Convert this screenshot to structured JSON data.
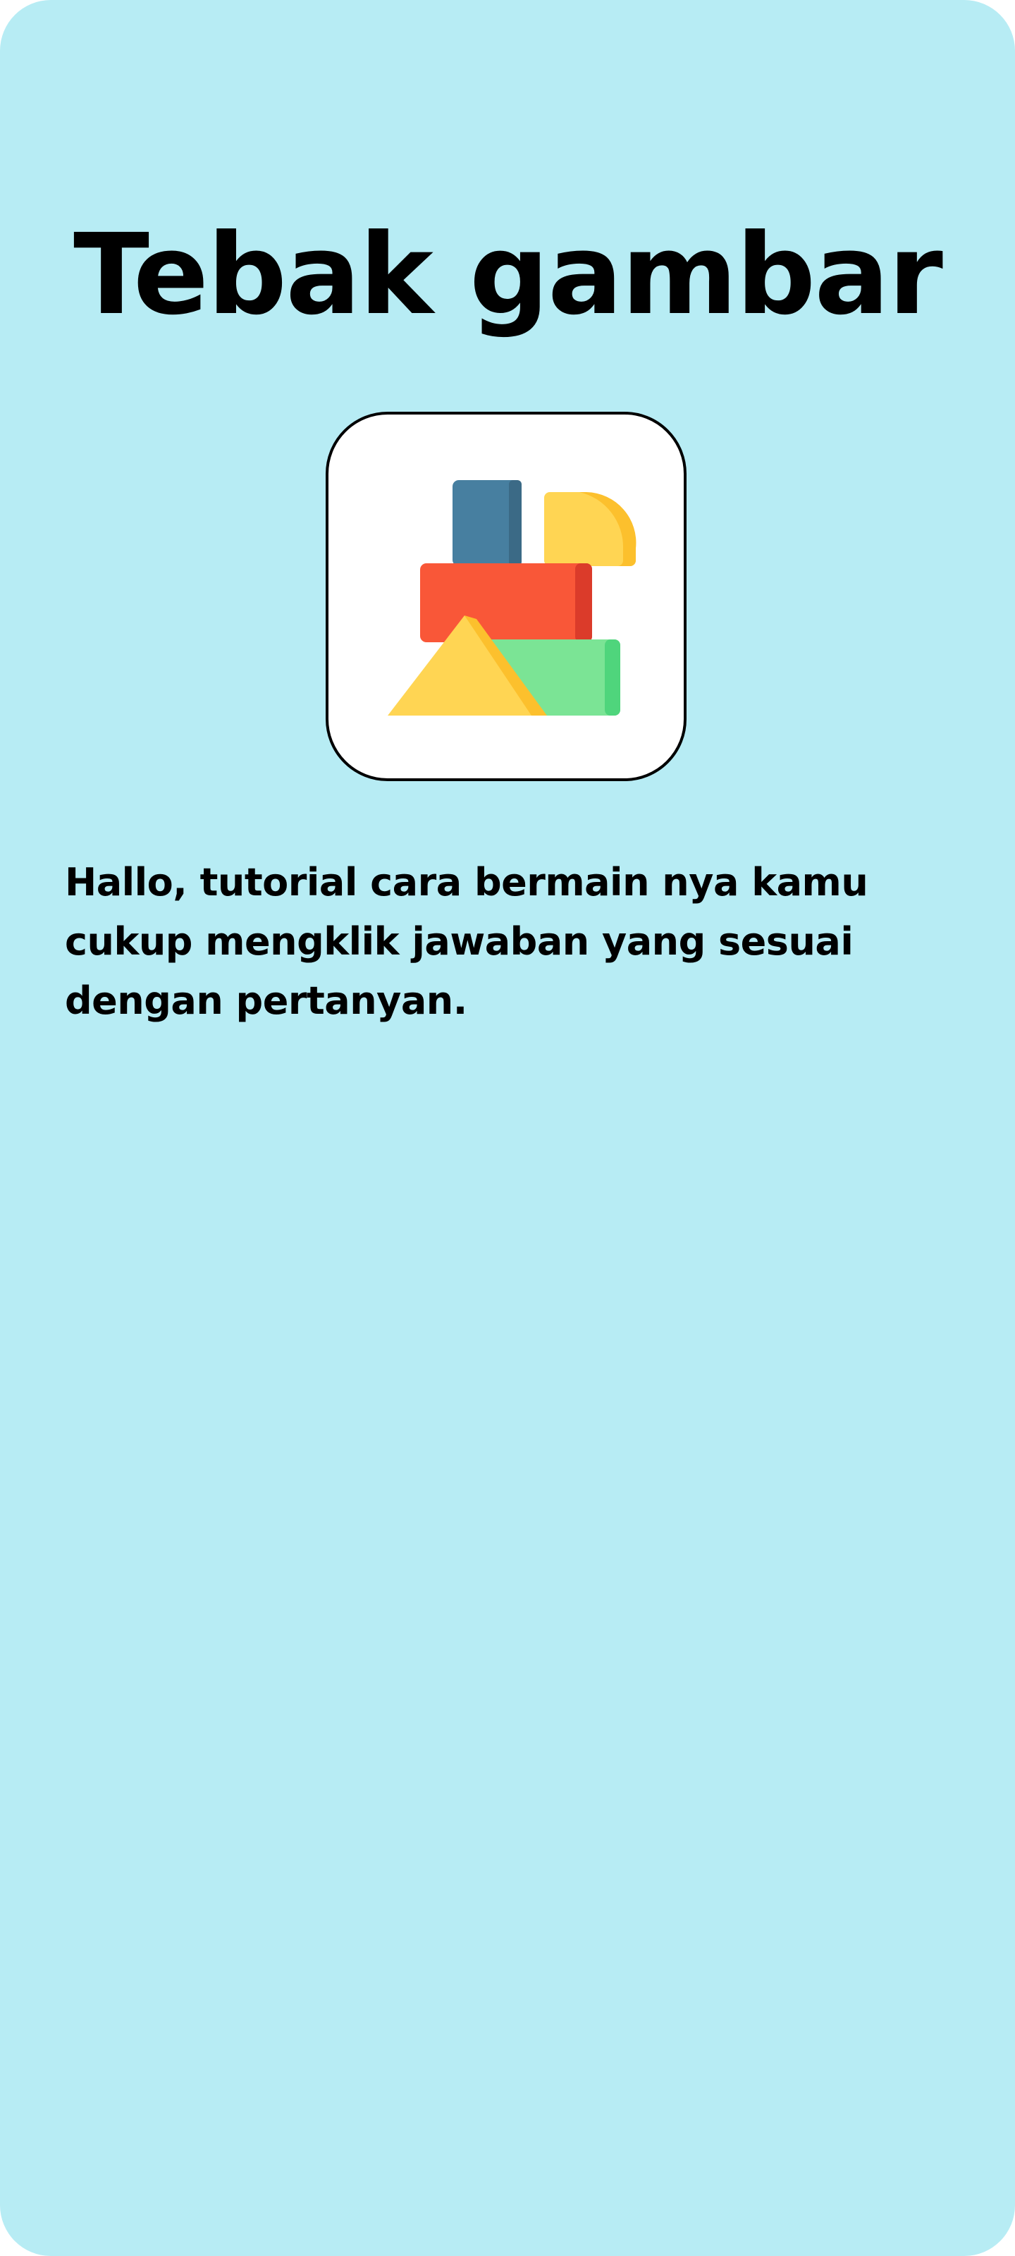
{
  "app": {
    "title": "Tebak gambar",
    "logo_icon": "toy-blocks-icon",
    "tutorial_text": "Hallo, tutorial cara bermain nya kamu cukup mengklik jawaban yang sesuai dengan pertanyan."
  },
  "colors": {
    "background": "#b7ecf4",
    "card": "#ffffff",
    "text": "#000000",
    "block_blue": "#477fa0",
    "block_red": "#f95738",
    "block_green": "#7be495",
    "block_yellow": "#ffd553"
  }
}
